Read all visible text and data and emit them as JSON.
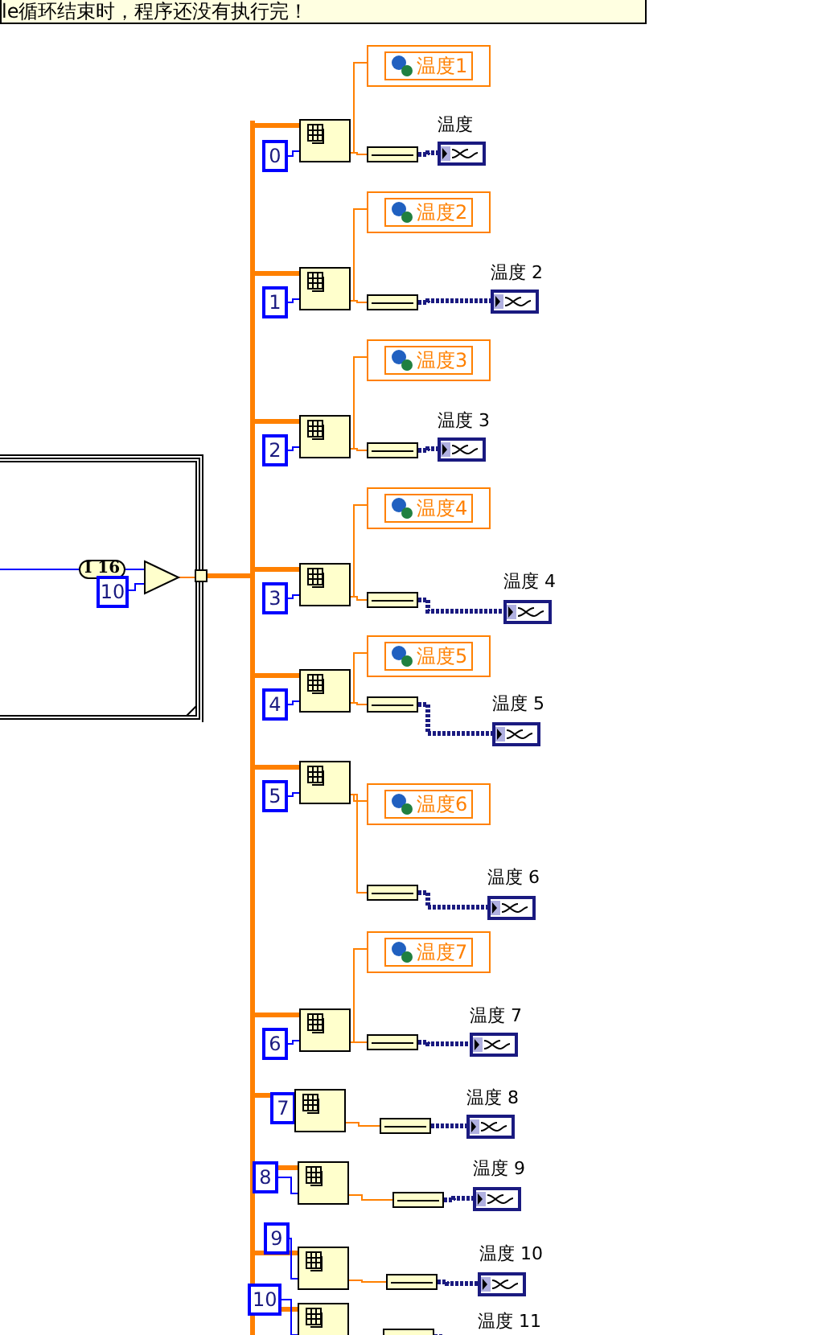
{
  "comment": "le循环结束时，程序还没有执行完！",
  "conversion": "I 16",
  "divisor": "10",
  "rows": [
    {
      "index": "0",
      "variable": "温度1",
      "indicator": "温度"
    },
    {
      "index": "1",
      "variable": "温度2",
      "indicator": "温度 2"
    },
    {
      "index": "2",
      "variable": "温度3",
      "indicator": "温度 3"
    },
    {
      "index": "3",
      "variable": "温度4",
      "indicator": "温度 4"
    },
    {
      "index": "4",
      "variable": "温度5",
      "indicator": "温度 5"
    },
    {
      "index": "5",
      "variable": "温度6",
      "indicator": "温度 6"
    },
    {
      "index": "6",
      "variable": "温度7",
      "indicator": "温度 7"
    },
    {
      "index": "7",
      "indicator": "温度 8"
    },
    {
      "index": "8",
      "indicator": "温度 9"
    },
    {
      "index": "9",
      "indicator": "温度 10"
    },
    {
      "index": "10",
      "indicator": "温度 11"
    }
  ]
}
